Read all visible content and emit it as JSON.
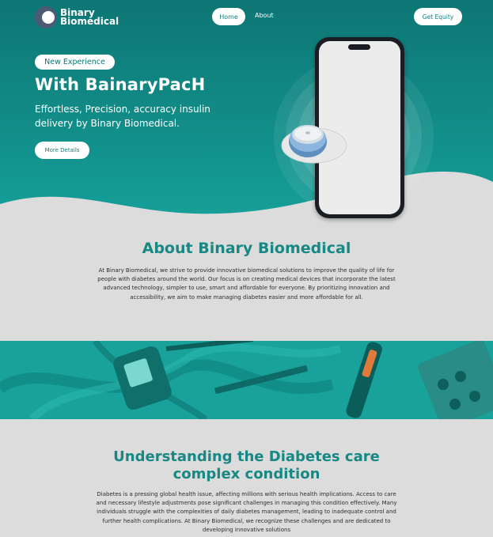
{
  "header": {
    "logo_line1": "Binary",
    "logo_line2": "Biomedical",
    "nav": [
      {
        "label": "Home",
        "active": true
      },
      {
        "label": "About",
        "active": false
      }
    ],
    "cta_label": "Get Equity"
  },
  "hero": {
    "badge": "New Experience",
    "title": "With BainaryPacH",
    "subtitle": "Effortless, Precision, accuracy insulin delivery by Binary Biomedical.",
    "button_label": "More Details"
  },
  "about": {
    "title": "About Binary Biomedical",
    "text": "At Binary Biomedical, we strive to provide innovative biomedical solutions to improve the quality of life for people with diabetes around the world. Our focus is on creating medical devices that incorporate the latest advanced technology, simpler to use, smart and affordable for everyone. By prioritizing innovation and accessibility, we aim to make managing diabetes easier and more affordable for all."
  },
  "understanding": {
    "title_line1": "Understanding the Diabetes care",
    "title_line2": "complex condition",
    "text": "Diabetes is a pressing global health issue, affecting millions with serious health implications. Access to care and necessary lifestyle adjustments pose significant challenges in managing this condition effectively. Many individuals struggle with the complexities of daily diabetes management, leading to inadequate control and further health complications. At Binary Biomedical, we recognize these challenges and are dedicated to developing innovative solutions"
  },
  "colors": {
    "brand_teal": "#137f7c",
    "heading_teal": "#178884",
    "hero_gradient_top": "#0e7674",
    "page_background": "#dcdcdc"
  },
  "icons": {
    "logo": "logo-mark-icon",
    "phone": "smartphone-illustration",
    "pump": "insulin-patch-pump-illustration"
  }
}
